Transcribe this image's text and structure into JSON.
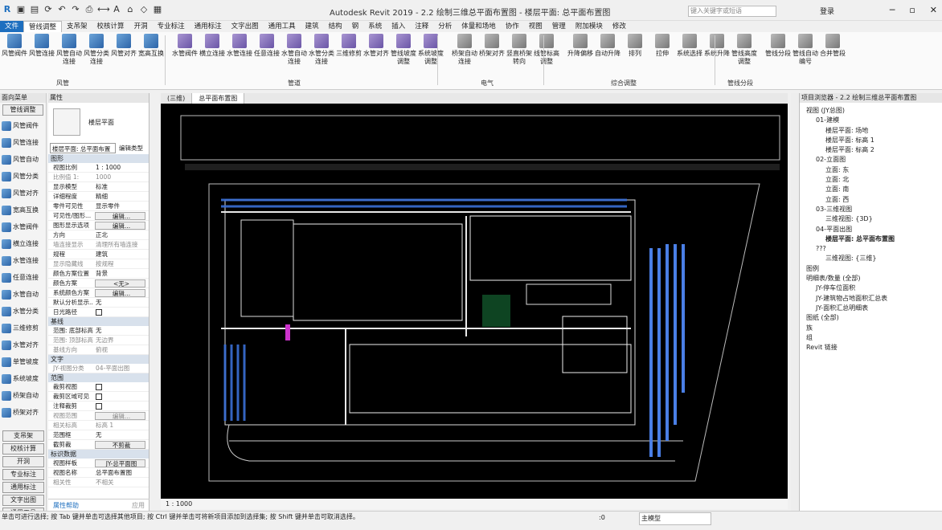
{
  "app": {
    "title": "Autodesk Revit 2019 - 2.2 绘制三维总平面布置图 - 楼层平面: 总平面布置图",
    "search_placeholder": "键入关键字或短语",
    "login": "登录"
  },
  "ribbon_tabs": [
    "文件",
    "管线调整",
    "支吊架",
    "校核计算",
    "开洞",
    "专业标注",
    "通用标注",
    "文字出图",
    "通用工具",
    "建筑",
    "结构",
    "钢",
    "系统",
    "插入",
    "注释",
    "分析",
    "体量和场地",
    "协作",
    "视图",
    "管理",
    "附加模块",
    "修改"
  ],
  "ribbon": {
    "buttons": [
      "风管阀件",
      "风管连接",
      "风管自动连接",
      "风管分类连接",
      "风管对齐",
      "宽高互换",
      "水管阀件",
      "横立连接",
      "水管连接",
      "任意连接",
      "水管自动连接",
      "水管分类连接",
      "三维修剪",
      "水管对齐",
      "管线坡度调整",
      "系统坡度调整",
      "桥架自动连接",
      "桥架对齐",
      "竖直桥架转向",
      "线管标高调整",
      "升降偏移",
      "自动升降",
      "排列",
      "拉伸",
      "系统选择",
      "系统升降",
      "管线高度调整",
      "管线分段",
      "管线自动编号",
      "合并管段"
    ],
    "panels": [
      "风管",
      "管道",
      "电气",
      "综合调整",
      "管线分段"
    ]
  },
  "left_palette": {
    "header": "面向菜单",
    "top_button": "管线调整",
    "items": [
      "风管阀件",
      "风管连接",
      "风管自动",
      "风管分类",
      "风管对齐",
      "宽高互换",
      "水管阀件",
      "横立连接",
      "水管连接",
      "任意连接",
      "水管自动",
      "水管分类",
      "三维修剪",
      "水管对齐",
      "单管坡度",
      "系统坡度",
      "桥架自动",
      "桥架对齐"
    ],
    "bottom_buttons": [
      "支吊架",
      "校核计算",
      "开洞",
      "专业标注",
      "通用标注",
      "文字出图",
      "通用工具"
    ]
  },
  "properties": {
    "title": "属性",
    "type_name": "楼层平面",
    "selector": "楼层平面: 总平面布置",
    "edit_type": "编辑类型",
    "groups": [
      {
        "name": "图形",
        "rows": [
          {
            "k": "视图比例",
            "v": "1 : 1000"
          },
          {
            "k": "比例值 1:",
            "v": "1000",
            "dim": true
          },
          {
            "k": "显示模型",
            "v": "标准"
          },
          {
            "k": "详细程度",
            "v": "精细"
          },
          {
            "k": "零件可见性",
            "v": "显示零件"
          },
          {
            "k": "可见性/图形...",
            "v": "编辑...",
            "btn": true
          },
          {
            "k": "图形显示选项",
            "v": "编辑...",
            "btn": true
          },
          {
            "k": "方向",
            "v": "正北"
          },
          {
            "k": "墙连接显示",
            "v": "清理所有墙连接",
            "dim": true
          },
          {
            "k": "规程",
            "v": "建筑"
          },
          {
            "k": "显示隐藏线",
            "v": "按规程",
            "dim": true
          },
          {
            "k": "颜色方案位置",
            "v": "背景"
          },
          {
            "k": "颜色方案",
            "v": "<无>",
            "btn": true
          },
          {
            "k": "系统颜色方案",
            "v": "编辑...",
            "btn": true
          },
          {
            "k": "默认分析显示...",
            "v": "无"
          },
          {
            "k": "日光路径",
            "v": "",
            "chk": true
          }
        ]
      },
      {
        "name": "基线",
        "rows": [
          {
            "k": "范围: 底部标高",
            "v": "无"
          },
          {
            "k": "范围: 顶部标高",
            "v": "无边界",
            "dim": true
          },
          {
            "k": "基线方向",
            "v": "俯视",
            "dim": true
          }
        ]
      },
      {
        "name": "文字",
        "rows": [
          {
            "k": "JY-视图分类",
            "v": "04-平面出图",
            "dim": true
          }
        ]
      },
      {
        "name": "范围",
        "rows": [
          {
            "k": "裁剪视图",
            "v": "",
            "chk": true
          },
          {
            "k": "裁剪区域可见",
            "v": "",
            "chk": true
          },
          {
            "k": "注释裁剪",
            "v": "",
            "chk": true
          },
          {
            "k": "视图范围",
            "v": "编辑...",
            "dim": true,
            "btn": true
          },
          {
            "k": "相关标高",
            "v": "标高 1",
            "dim": true
          },
          {
            "k": "范围框",
            "v": "无"
          },
          {
            "k": "截剪裁",
            "v": "不剪裁",
            "btn": true
          }
        ]
      },
      {
        "name": "标识数据",
        "rows": [
          {
            "k": "视图样板",
            "v": "JY-总平面图",
            "btn": true
          },
          {
            "k": "视图名称",
            "v": "总平面布置图"
          },
          {
            "k": "相关性",
            "v": "不相关",
            "dim": true
          }
        ]
      }
    ],
    "help": "属性帮助",
    "apply": "应用"
  },
  "view_tabs": [
    "(三维)",
    "总平面布置图"
  ],
  "view_control": {
    "scale": "1 : 1000"
  },
  "browser": {
    "title": "项目浏览器 - 2.2 绘制三维总平面布置图",
    "nodes": [
      {
        "t": "视图 (JY总图)",
        "d": 0
      },
      {
        "t": "01-建模",
        "d": 1
      },
      {
        "t": "楼层平面: 场地",
        "d": 2
      },
      {
        "t": "楼层平面: 标高 1",
        "d": 2
      },
      {
        "t": "楼层平面: 标高 2",
        "d": 2
      },
      {
        "t": "02-立面图",
        "d": 1
      },
      {
        "t": "立面: 东",
        "d": 2
      },
      {
        "t": "立面: 北",
        "d": 2
      },
      {
        "t": "立面: 南",
        "d": 2
      },
      {
        "t": "立面: 西",
        "d": 2
      },
      {
        "t": "03-三维视图",
        "d": 1
      },
      {
        "t": "三维视图: {3D}",
        "d": 2
      },
      {
        "t": "04-平面出图",
        "d": 1
      },
      {
        "t": "楼层平面: 总平面布置图",
        "d": 2,
        "sel": true
      },
      {
        "t": "???",
        "d": 1
      },
      {
        "t": "三维视图: {三维}",
        "d": 2
      },
      {
        "t": "图例",
        "d": 0
      },
      {
        "t": "明细表/数量 (全部)",
        "d": 0
      },
      {
        "t": "JY-停车位面积",
        "d": 1
      },
      {
        "t": "JY-建筑物占地面积汇总表",
        "d": 1
      },
      {
        "t": "JY-面积汇总明细表",
        "d": 1
      },
      {
        "t": "图纸 (全部)",
        "d": 0
      },
      {
        "t": "族",
        "d": 0
      },
      {
        "t": "组",
        "d": 0
      },
      {
        "t": "Revit 链接",
        "d": 0
      }
    ]
  },
  "status": {
    "text": "单击可进行选择; 按 Tab 键并单击可选择其他项目; 按 Ctrl 键并单击可将新项目添加到选择集; 按 Shift 键并单击可取消选择。",
    "zero": ":0",
    "model": "主模型"
  }
}
